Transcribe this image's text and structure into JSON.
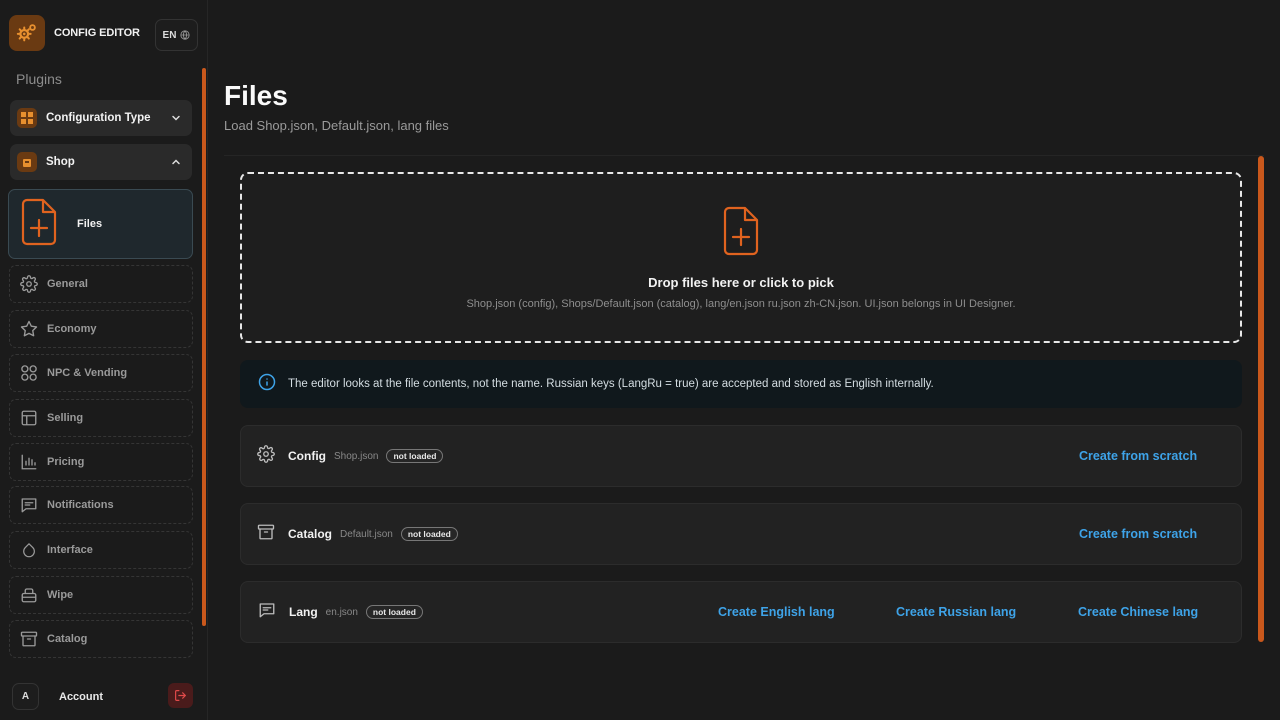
{
  "brand": {
    "title": "CONFIG EDITOR",
    "lang": "EN"
  },
  "sidebar": {
    "section_label": "Plugins",
    "groups": [
      {
        "label": "Configuration Type",
        "expanded": false
      },
      {
        "label": "Shop",
        "expanded": true
      }
    ],
    "active_item": "Files",
    "items": [
      {
        "label": "General"
      },
      {
        "label": "Economy"
      },
      {
        "label": "NPC & Vending"
      },
      {
        "label": "Selling"
      },
      {
        "label": "Pricing"
      },
      {
        "label": "Notifications"
      },
      {
        "label": "Interface"
      },
      {
        "label": "Wipe"
      },
      {
        "label": "Catalog"
      }
    ],
    "account": {
      "avatar": "A",
      "label": "Account"
    }
  },
  "main": {
    "title": "Files",
    "subtitle": "Load Shop.json, Default.json, lang files",
    "dropzone": {
      "title": "Drop files here or click to pick",
      "hint": "Shop.json (config), Shops/Default.json (catalog), lang/en.json ru.json zh-CN.json. UI.json belongs in UI Designer."
    },
    "info": "The editor looks at the file contents, not the name. Russian keys (LangRu = true) are accepted and stored as English internally.",
    "files": [
      {
        "name": "Config",
        "file": "Shop.json",
        "status": "not loaded",
        "actions": [
          "Create from scratch"
        ]
      },
      {
        "name": "Catalog",
        "file": "Default.json",
        "status": "not loaded",
        "actions": [
          "Create from scratch"
        ]
      },
      {
        "name": "Lang",
        "file": "en.json",
        "status": "not loaded",
        "actions": [
          "Create English lang",
          "Create Russian lang",
          "Create Chinese lang"
        ]
      }
    ]
  },
  "colors": {
    "accent": "#c9581c",
    "link": "#3ea3e8",
    "background": "#1b1b1b"
  }
}
